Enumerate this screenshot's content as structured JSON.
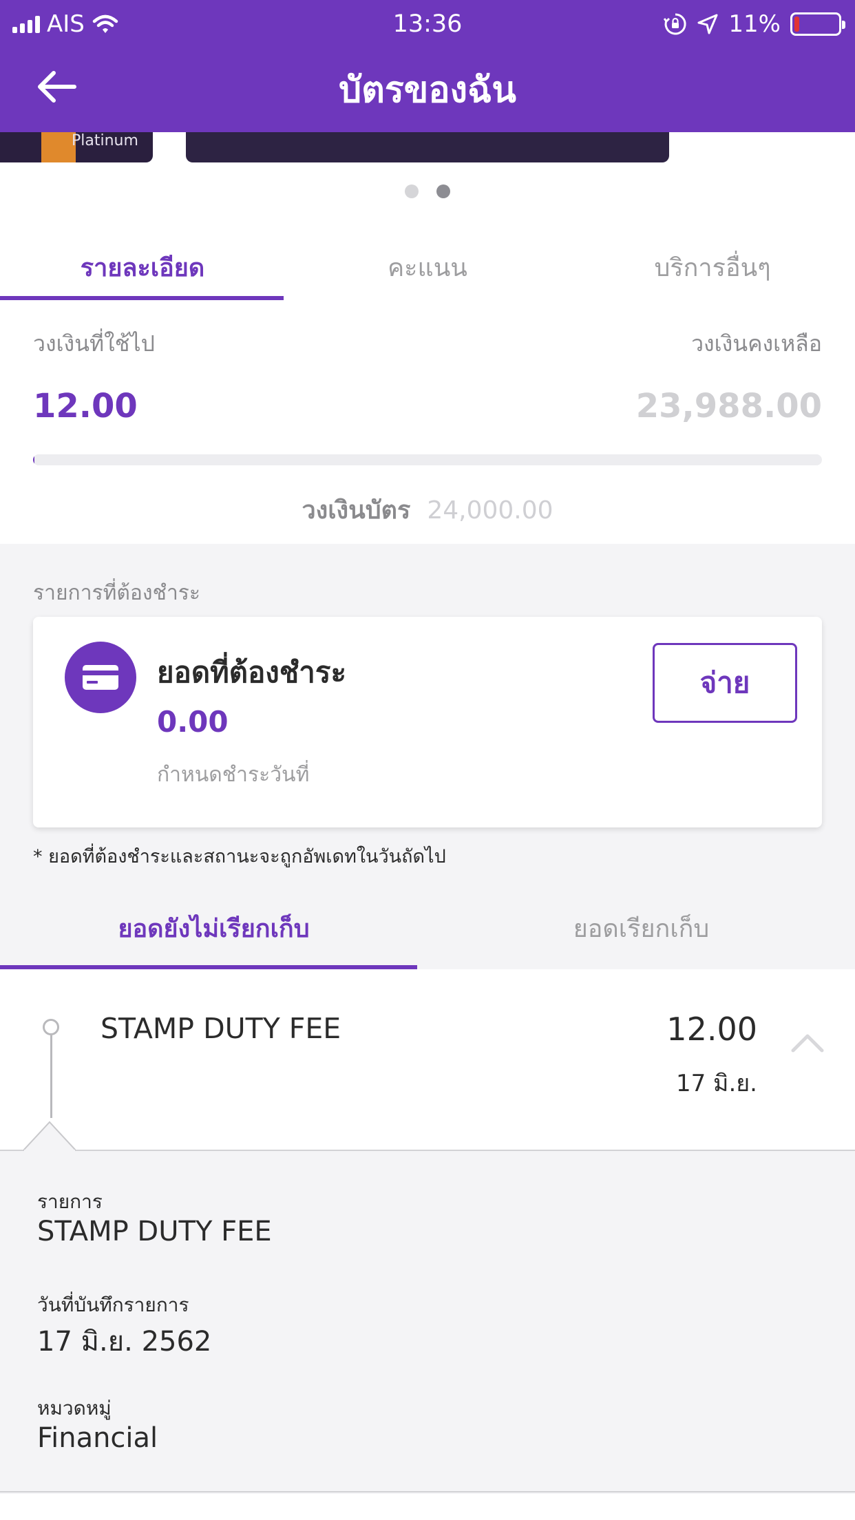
{
  "status_bar": {
    "carrier": "AIS",
    "time": "13:36",
    "battery_percent": "11%",
    "battery_level": 0.11
  },
  "header": {
    "title": "บัตรของฉัน",
    "back_icon": "arrow-left-icon"
  },
  "carousel": {
    "card_label": "Platinum",
    "active_index": 1,
    "count": 2
  },
  "tabs": [
    {
      "label": "รายละเอียด",
      "active": true
    },
    {
      "label": "คะแนน",
      "active": false
    },
    {
      "label": "บริการอื่นๆ",
      "active": false
    }
  ],
  "credit": {
    "used_label": "วงเงินที่ใช้ไป",
    "used_value": "12.00",
    "remaining_label": "วงเงินคงเหลือ",
    "remaining_value": "23,988.00",
    "limit_label": "วงเงินบัตร",
    "limit_value": "24,000.00",
    "used_fraction": 0.0005
  },
  "payment": {
    "section_label": "รายการที่ต้องชำระ",
    "title": "ยอดที่ต้องชำระ",
    "amount": "0.00",
    "due_label": "กำหนดชำระวันที่",
    "pay_button": "จ่าย",
    "footnote": "* ยอดที่ต้องชำระและสถานะจะถูกอัพเดทในวันถัดไป",
    "icon": "credit-card-icon"
  },
  "statement_tabs": [
    {
      "label": "ยอดยังไม่เรียกเก็บ",
      "active": true
    },
    {
      "label": "ยอดเรียกเก็บ",
      "active": false
    }
  ],
  "transaction": {
    "name": "STAMP DUTY FEE",
    "amount": "12.00",
    "date": "17 มิ.ย.",
    "expand_icon": "chevron-up-icon",
    "details": [
      {
        "label": "รายการ",
        "value": "STAMP DUTY FEE"
      },
      {
        "label": "วันที่บันทึกรายการ",
        "value": "17 มิ.ย. 2562"
      },
      {
        "label": "หมวดหมู่",
        "value": "Financial"
      }
    ]
  },
  "colors": {
    "brand": "#6e37bc",
    "battery_low": "#e13434"
  }
}
